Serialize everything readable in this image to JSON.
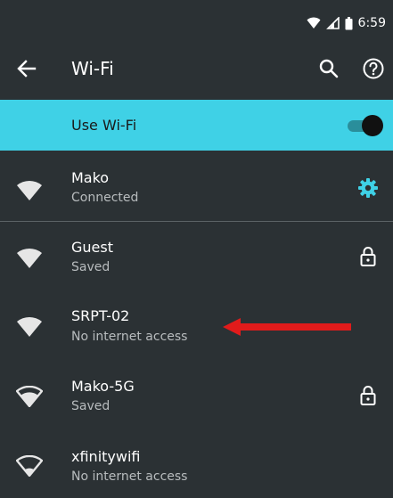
{
  "status_bar": {
    "time": "6:59",
    "icons": [
      "wifi-signal-icon",
      "cell-signal-icon",
      "battery-icon"
    ]
  },
  "app_bar": {
    "title": "Wi-Fi",
    "icons": [
      "back-arrow-icon",
      "search-icon",
      "help-icon"
    ]
  },
  "use_wifi": {
    "label": "Use Wi-Fi",
    "enabled": true,
    "accent_color": "#3fd1e6"
  },
  "networks": [
    {
      "name": "Mako",
      "status": "Connected",
      "trailing_icon": "settings-gear-icon"
    },
    {
      "name": "Guest",
      "status": "Saved",
      "trailing_icon": "lock-icon"
    },
    {
      "name": "SRPT-02",
      "status": "No internet access",
      "trailing_icon": ""
    },
    {
      "name": "Mako-5G",
      "status": "Saved",
      "trailing_icon": "lock-icon"
    },
    {
      "name": "xfinitywifi",
      "status": "No internet access",
      "trailing_icon": ""
    }
  ],
  "annotation": {
    "icon": "red-arrow-icon",
    "color": "#e11b1b"
  },
  "colors": {
    "background": "#2b3134",
    "secondary_text": "#b8bcbe"
  }
}
